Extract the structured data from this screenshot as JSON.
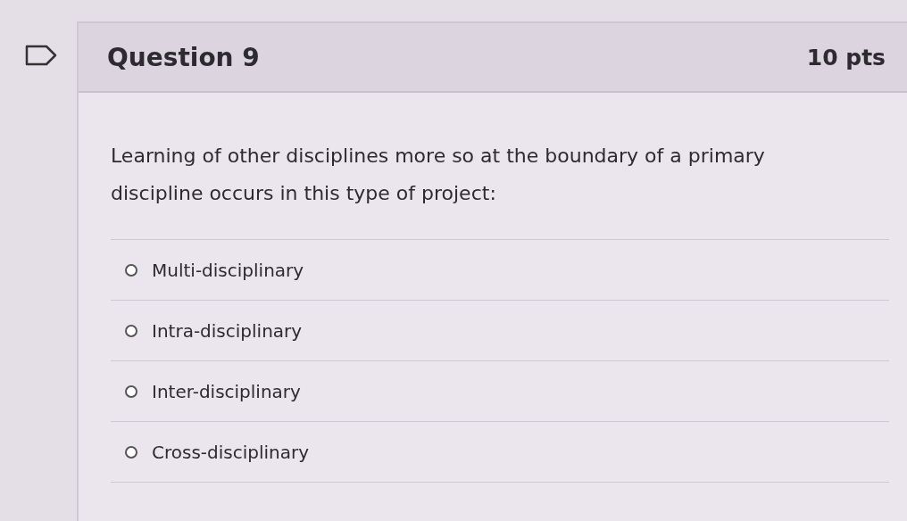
{
  "question": {
    "title": "Question 9",
    "points": "10 pts",
    "text": "Learning of other disciplines more so at the boundary of a primary discipline occurs in this type of project:"
  },
  "answers": [
    {
      "label": "Multi-disciplinary",
      "selected": false
    },
    {
      "label": "Intra-disciplinary",
      "selected": false
    },
    {
      "label": "Inter-disciplinary",
      "selected": false
    },
    {
      "label": "Cross-disciplinary",
      "selected": false
    }
  ]
}
